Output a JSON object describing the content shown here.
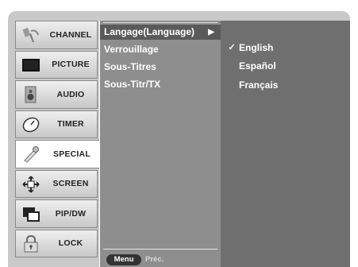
{
  "sidebar": {
    "items": [
      {
        "label": "CHANNEL",
        "icon": "antenna-icon"
      },
      {
        "label": "PICTURE",
        "icon": "picture-icon"
      },
      {
        "label": "AUDIO",
        "icon": "speaker-icon"
      },
      {
        "label": "TIMER",
        "icon": "timer-icon"
      },
      {
        "label": "SPECIAL",
        "icon": "special-icon",
        "active": true
      },
      {
        "label": "SCREEN",
        "icon": "screen-adjust-icon"
      },
      {
        "label": "PIP/DW",
        "icon": "pip-icon"
      },
      {
        "label": "LOCK",
        "icon": "lock-icon"
      }
    ]
  },
  "submenu": {
    "items": [
      {
        "label": "Langage(Language)",
        "selected": true,
        "arrow": "▶"
      },
      {
        "label": "Verrouillage"
      },
      {
        "label": "Sous-Titres"
      },
      {
        "label": "Sous-Titr/TX"
      }
    ],
    "menu_button": "Menu",
    "prev_label": "Préc."
  },
  "options": {
    "items": [
      {
        "label": "English",
        "checked": true,
        "check": "✓"
      },
      {
        "label": "Español"
      },
      {
        "label": "Français"
      }
    ]
  },
  "colors": {
    "frame": "#c9c9c9",
    "submenu_bg": "#8e8e8e",
    "submenu_selected": "#5a5a5a",
    "options_bg": "#6f6f6f"
  }
}
